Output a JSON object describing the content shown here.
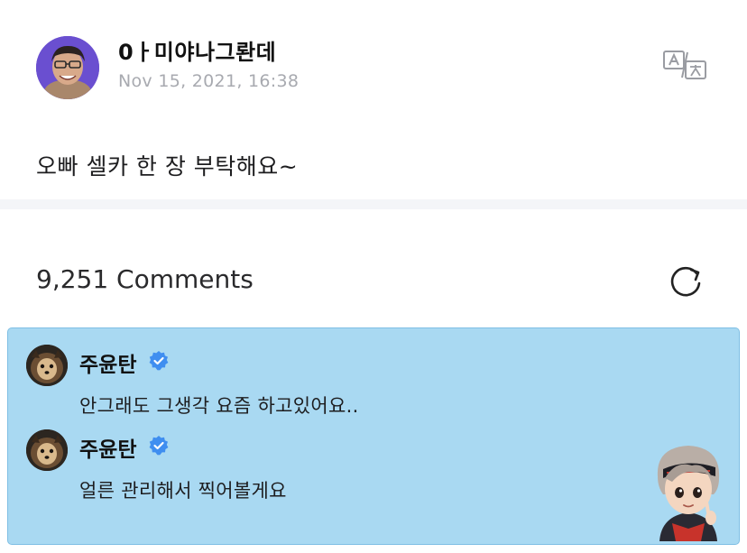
{
  "post": {
    "author_name": "0ㅏ미야나그롼데",
    "date": "Nov 15, 2021, 16:38",
    "body": "오빠 셀카 한 장 부탁해요~"
  },
  "comments_section": {
    "count_label": "9,251 Comments"
  },
  "comments": [
    {
      "author": "주윤탄",
      "text": "안그래도 그생각 요즘 하고있어요.."
    },
    {
      "author": "주윤탄",
      "text": "얼른 관리해서 찍어볼게요"
    }
  ],
  "icons": {
    "translate": "translate-icon",
    "refresh": "refresh-icon",
    "verified": "verified-badge-icon"
  },
  "colors": {
    "comment_highlight_bg": "#a9d9f2",
    "verified_blue": "#3f8ef0",
    "date_gray": "#a8aab0"
  }
}
